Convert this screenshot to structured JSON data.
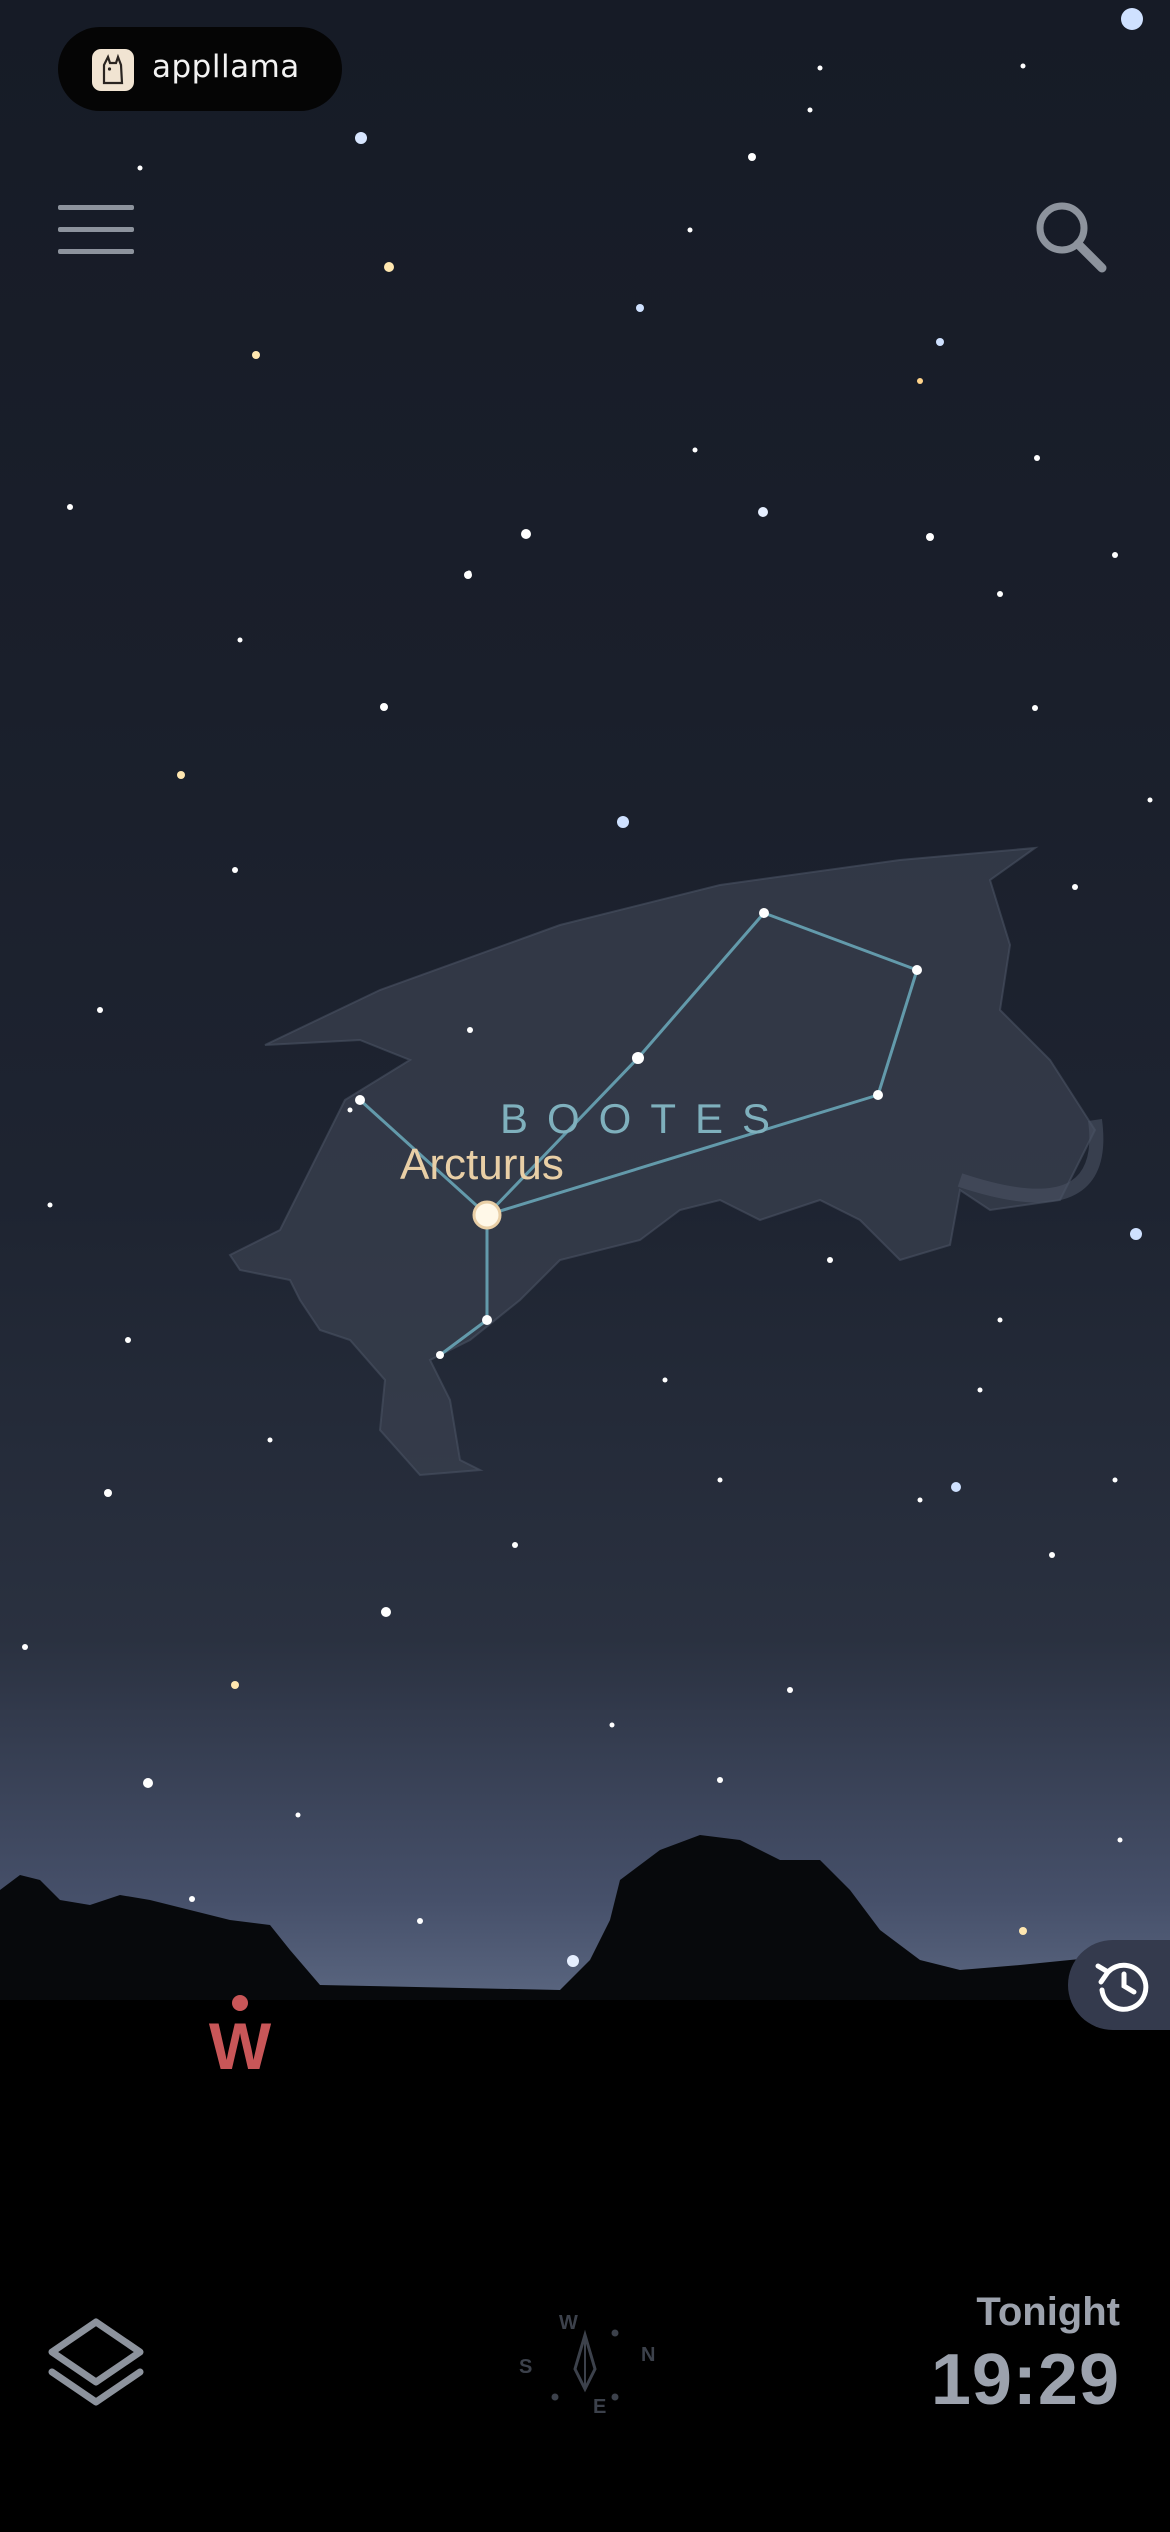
{
  "app": {
    "brand": "appllama"
  },
  "icons": {
    "menu": "hamburger-menu-icon",
    "search": "search-icon",
    "history": "history-clock-icon",
    "layers": "layers-icon",
    "compass": "compass-icon"
  },
  "sky": {
    "constellation": "BOOTES",
    "highlighted_star": "Arcturus",
    "horizon_direction": "W"
  },
  "compass_rose": {
    "north": "N",
    "south": "S",
    "east": "E",
    "west": "W"
  },
  "time": {
    "label": "Tonight",
    "value": "19:29"
  },
  "colors": {
    "accent_constellation": "#7fb0bd",
    "star_label": "#e9cfa6",
    "direction_marker": "#c85658",
    "ui_gray": "#9ca2ad"
  }
}
